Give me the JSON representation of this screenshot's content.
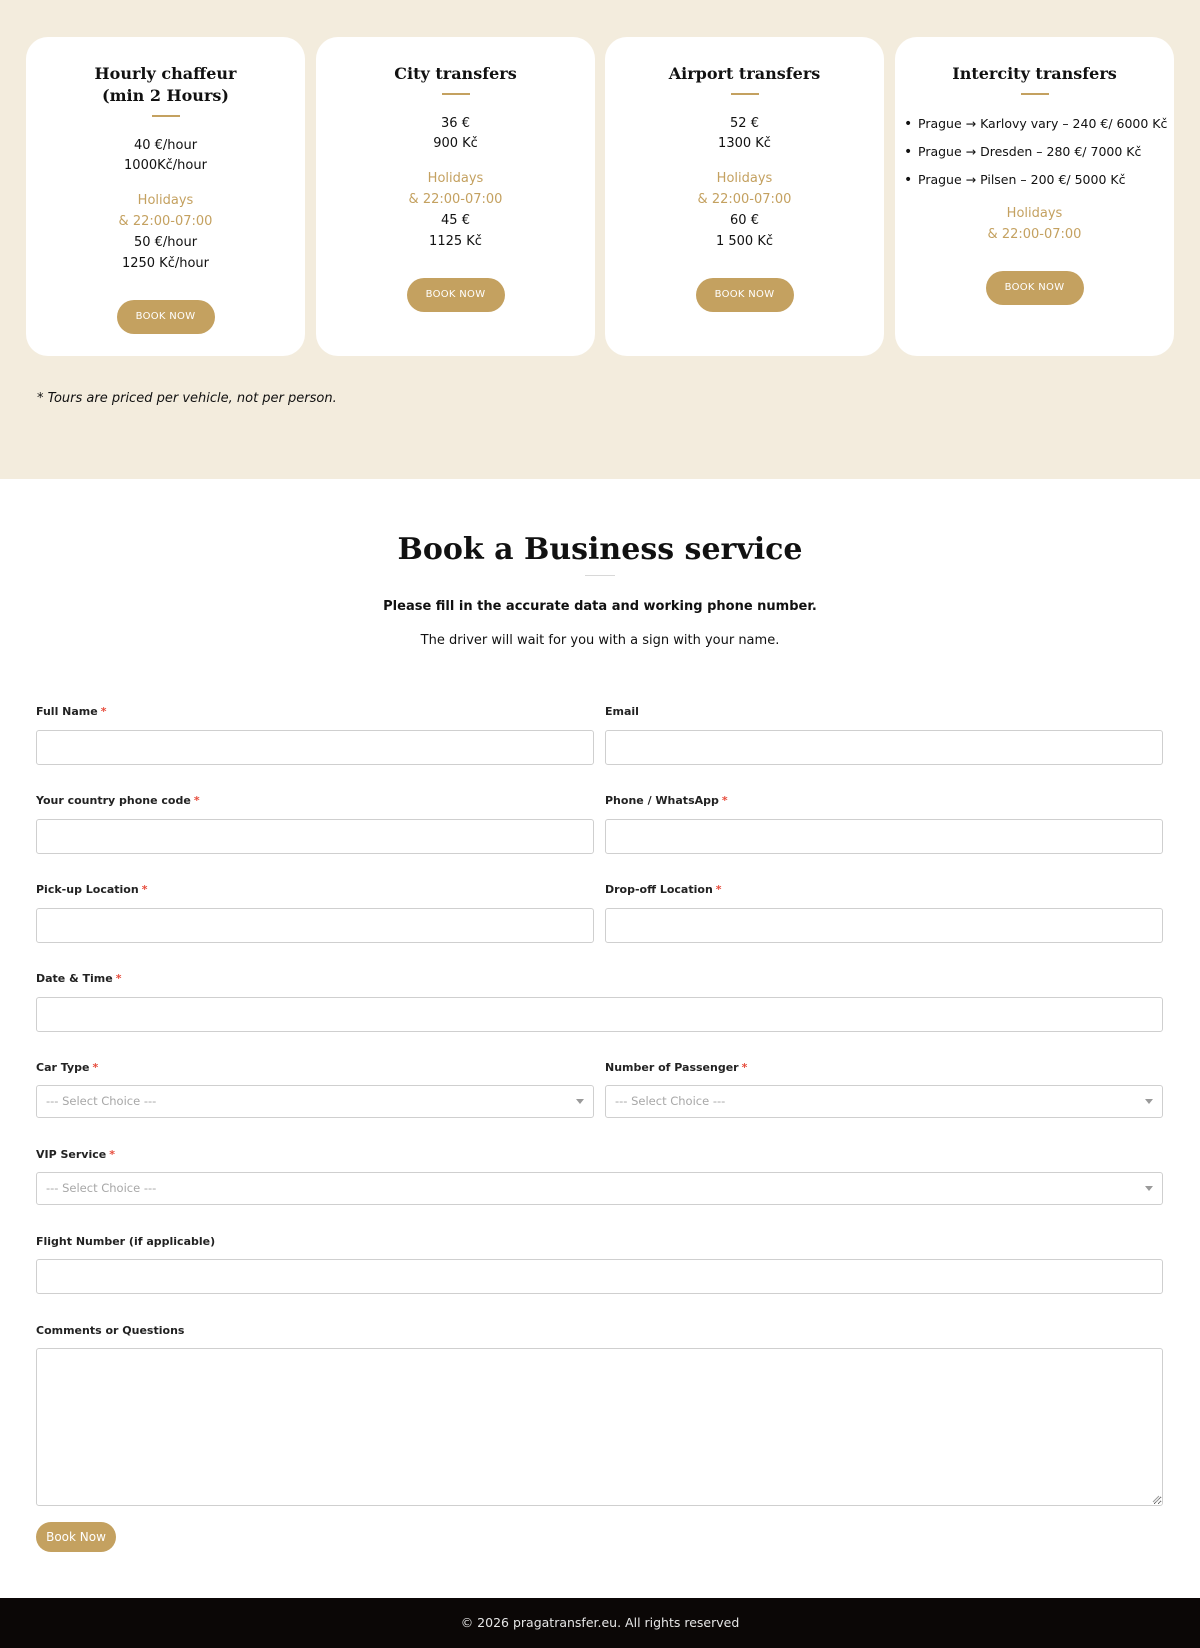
{
  "pricing": {
    "cards": [
      {
        "title_line1": "Hourly chaffeur",
        "title_line2": "(min 2 Hours)",
        "prices": [
          "40 €/hour",
          "1000Kč/hour"
        ],
        "holidays_label": "Holidays",
        "night_label": "& 22:00-07:00",
        "holiday_prices": [
          "50 €/hour",
          "1250 Kč/hour"
        ],
        "button_label": "BOOK NOW"
      },
      {
        "title_line1": "City transfers",
        "prices": [
          "36 €",
          "900 Kč"
        ],
        "holidays_label": "Holidays",
        "night_label": "& 22:00-07:00",
        "holiday_prices": [
          "45 €",
          "1125 Kč"
        ],
        "button_label": "BOOK NOW"
      },
      {
        "title_line1": "Airport transfers",
        "prices": [
          "52 €",
          "1300 Kč"
        ],
        "holidays_label": "Holidays",
        "night_label": "& 22:00-07:00",
        "holiday_prices": [
          "60 €",
          "1 500 Kč"
        ],
        "button_label": "BOOK NOW"
      },
      {
        "title_line1": "Intercity transfers",
        "routes": [
          "Prague → Karlovy vary – 240 €/ 6000 Kč",
          "Prague → Dresden – 280 €/ 7000 Kč",
          "Prague → Pilsen – 200 €/ 5000 Kč"
        ],
        "holidays_label": "Holidays",
        "night_label": "& 22:00-07:00",
        "button_label": "BOOK NOW"
      }
    ],
    "note": "* Tours are priced per vehicle, not per person."
  },
  "booking": {
    "heading": "Book a Business service",
    "subtitle_bold": "Please fill in the accurate data and working phone number.",
    "subtitle": "The driver will wait for you with a sign with your name.",
    "required_mark": "*",
    "fields": {
      "full_name": "Full Name",
      "email": "Email",
      "phone_code": "Your country phone code",
      "phone": "Phone / WhatsApp",
      "pickup": "Pick-up Location",
      "dropoff": "Drop-off Location",
      "datetime": "Date & Time",
      "car_type": "Car Type",
      "passengers": "Number of Passenger",
      "vip": "VIP Service",
      "flight": "Flight Number (if applicable)",
      "comments": "Comments or Questions"
    },
    "select_placeholder": "--- Select Choice ---",
    "submit_label": "Book Now"
  },
  "footer": {
    "text": "© 2026 pragatransfer.eu. All rights reserved"
  },
  "colors": {
    "accent": "#c4a160",
    "section_bg": "#f3ecdd",
    "footer_bg": "#0b0706",
    "required": "#e74c3c"
  }
}
